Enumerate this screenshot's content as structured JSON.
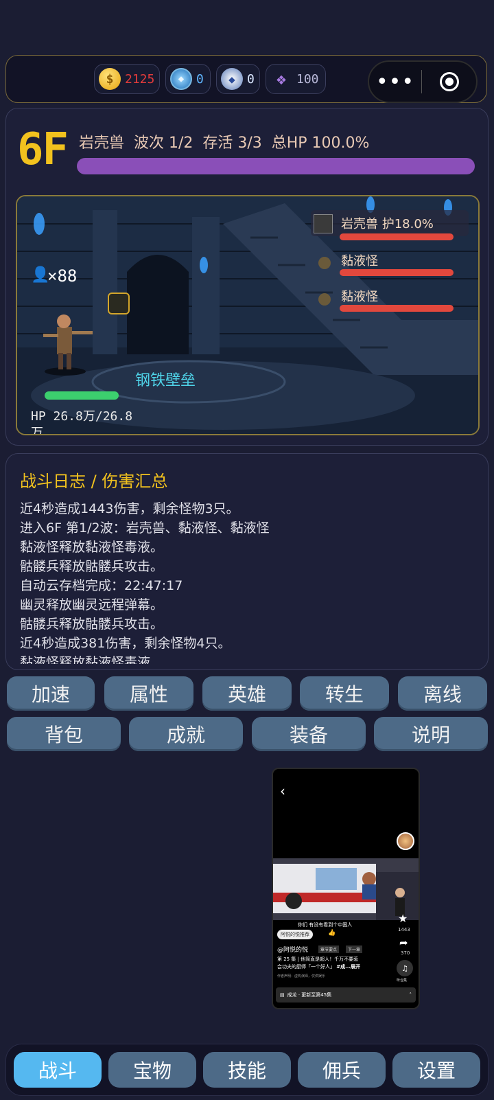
{
  "currency": [
    {
      "icon": "gold-coin-icon",
      "value": "2125",
      "color": "#e23b3b"
    },
    {
      "icon": "blue-gem-icon",
      "value": "0",
      "color": "#5fb6ff"
    },
    {
      "icon": "diamond-icon",
      "value": "0",
      "color": "#d9e6ff"
    },
    {
      "icon": "purple-crystal-icon",
      "value": "100",
      "color": "#b8b8d8"
    }
  ],
  "capsule": {
    "more": "•••"
  },
  "battle": {
    "floor": "6F",
    "stats": "岩壳兽  波次 1/2  存活 3/3  总HP 100.0%",
    "boss_hp_fraction": 1.0,
    "party_count": "×88",
    "skill_name": "钢铁壁垒",
    "hero_hp_text": "HP 26.8万/26.8",
    "hero_hp_text_wrap": "万",
    "hero_hp_fraction": 1.0,
    "enemies": [
      {
        "name": "岩壳兽 护18.0%",
        "hp_fraction": 1.0
      },
      {
        "name": "黏液怪",
        "hp_fraction": 1.0
      },
      {
        "name": "黏液怪",
        "hp_fraction": 1.0
      }
    ]
  },
  "log": {
    "title": "战斗日志 / 伤害汇总",
    "lines": [
      "近4秒造成1443伤害，剩余怪物3只。",
      "进入6F 第1/2波：岩壳兽、黏液怪、黏液怪",
      "黏液怪释放黏液怪毒液。",
      "骷髅兵释放骷髅兵攻击。",
      "自动云存档完成：22:47:17",
      "幽灵释放幽灵远程弹幕。",
      "骷髅兵释放骷髅兵攻击。",
      "近4秒造成381伤害，剩余怪物4只。",
      "黏液怪释放黏液怪毒液"
    ]
  },
  "actions_row1": [
    "加速",
    "属性",
    "英雄",
    "转生",
    "离线"
  ],
  "actions_row2": [
    "背包",
    "成就",
    "装备",
    "说明"
  ],
  "ad": {
    "caption": "你们 有没有看到个中国人",
    "channel": "阿悦的悦推荐",
    "chapter": "章节要点",
    "next": "下一章",
    "author": "@阿悦的悦",
    "desc_line1": "第 25 集 | 他简直是超人！千万不要惹",
    "desc_line2": "会功夫的厨师「一个好人」",
    "desc_tag": "#成...展开",
    "disclaimer": "作者声明：虚构演绎，仅供娱乐",
    "likes": "1443",
    "shares": "370",
    "listen": "听合集",
    "series": "成龙 · 更新至第45集"
  },
  "nav": [
    {
      "label": "战斗",
      "active": true
    },
    {
      "label": "宝物",
      "active": false
    },
    {
      "label": "技能",
      "active": false
    },
    {
      "label": "佣兵",
      "active": false
    },
    {
      "label": "设置",
      "active": false
    }
  ]
}
